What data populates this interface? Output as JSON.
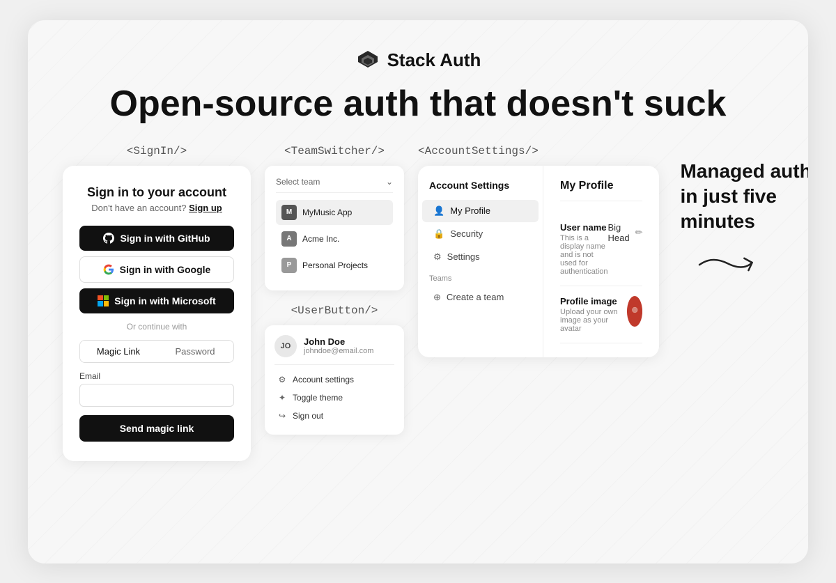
{
  "app": {
    "title": "Stack Auth",
    "headline": "Open-source auth that doesn't suck"
  },
  "signin_component": {
    "label": "<SignIn/>",
    "title": "Sign in to your account",
    "subtitle_text": "Don't have an account?",
    "signup_link": "Sign up",
    "github_btn": "Sign in with GitHub",
    "google_btn": "Sign in with Google",
    "microsoft_btn": "Sign in with Microsoft",
    "or_text": "Or continue with",
    "tab_magic": "Magic Link",
    "tab_password": "Password",
    "email_label": "Email",
    "email_placeholder": "",
    "magic_btn": "Send magic link"
  },
  "team_switcher": {
    "label": "<TeamSwitcher/>",
    "select_label": "Select team",
    "teams": [
      {
        "initial": "M",
        "name": "MyMusic App",
        "color": "#6c6c6c",
        "active": true
      },
      {
        "initial": "A",
        "name": "Acme Inc.",
        "color": "#888"
      },
      {
        "initial": "P",
        "name": "Personal Projects",
        "color": "#aaa"
      }
    ]
  },
  "user_button": {
    "label": "<UserButton/>",
    "initials": "JO",
    "name": "John Doe",
    "email": "johndoe@email.com",
    "menu_items": [
      {
        "icon": "⚙",
        "label": "Account settings"
      },
      {
        "icon": "✦",
        "label": "Toggle theme"
      },
      {
        "icon": "→",
        "label": "Sign out"
      }
    ]
  },
  "account_settings": {
    "label": "<AccountSettings/>",
    "sidebar_title": "Account Settings",
    "nav_items": [
      {
        "icon": "👤",
        "label": "My Profile",
        "active": true
      },
      {
        "icon": "🔒",
        "label": "Security"
      },
      {
        "icon": "⚙",
        "label": "Settings"
      }
    ],
    "teams_section": "Teams",
    "create_team": "Create a team",
    "main_title": "My Profile",
    "fields": [
      {
        "label": "User name",
        "desc": "This is a display name and is not used for authentication",
        "value": "Big Head",
        "has_edit": true
      },
      {
        "label": "Profile image",
        "desc": "Upload your own image as your avatar",
        "value": "",
        "has_avatar": true
      }
    ]
  },
  "managed_auth": {
    "line1": "Managed auth",
    "line2": "in just five minutes"
  }
}
